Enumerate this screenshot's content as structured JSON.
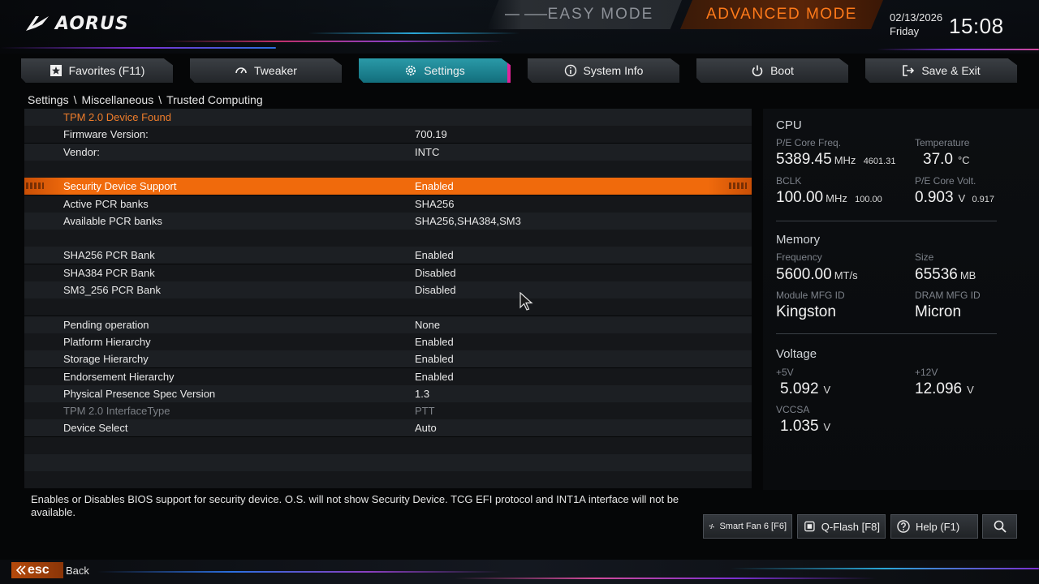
{
  "header": {
    "brand": "AORUS",
    "easy_mode": "EASY MODE",
    "advanced_mode": "ADVANCED MODE",
    "date": "02/13/2026",
    "day": "Friday",
    "time": "15:08",
    "accent_color": "#ff7a1a"
  },
  "tabs": [
    {
      "label": "Favorites (F11)",
      "icon": "star-icon",
      "active": false
    },
    {
      "label": "Tweaker",
      "icon": "gauge-icon",
      "active": false
    },
    {
      "label": "Settings",
      "icon": "gear-icon",
      "active": true
    },
    {
      "label": "System Info",
      "icon": "info-icon",
      "active": false
    },
    {
      "label": "Boot",
      "icon": "power-icon",
      "active": false
    },
    {
      "label": "Save & Exit",
      "icon": "exit-icon",
      "active": false
    }
  ],
  "breadcrumb": [
    "Settings",
    "Miscellaneous",
    "Trusted Computing"
  ],
  "breadcrumb_sep": "\\",
  "settings": [
    {
      "label": "TPM 2.0 Device Found",
      "value": "",
      "style": "header"
    },
    {
      "label": "Firmware Version:",
      "value": "700.19"
    },
    {
      "label": "Vendor:",
      "value": "INTC"
    },
    {
      "label": "",
      "value": ""
    },
    {
      "label": "Security Device Support",
      "value": "Enabled",
      "style": "selected"
    },
    {
      "label": "Active PCR banks",
      "value": "SHA256"
    },
    {
      "label": "Available PCR banks",
      "value": "SHA256,SHA384,SM3"
    },
    {
      "label": "",
      "value": ""
    },
    {
      "label": "SHA256 PCR Bank",
      "value": "Enabled"
    },
    {
      "label": "SHA384 PCR Bank",
      "value": "Disabled"
    },
    {
      "label": "SM3_256 PCR Bank",
      "value": "Disabled"
    },
    {
      "label": "",
      "value": ""
    },
    {
      "label": "Pending operation",
      "value": "None"
    },
    {
      "label": "Platform Hierarchy",
      "value": "Enabled"
    },
    {
      "label": "Storage Hierarchy",
      "value": "Enabled"
    },
    {
      "label": "Endorsement Hierarchy",
      "value": "Enabled"
    },
    {
      "label": "Physical Presence Spec Version",
      "value": "1.3"
    },
    {
      "label": "TPM 2.0 InterfaceType",
      "value": "PTT",
      "style": "dim"
    },
    {
      "label": "Device Select",
      "value": "Auto"
    },
    {
      "label": "",
      "value": ""
    },
    {
      "label": "",
      "value": ""
    },
    {
      "label": "",
      "value": ""
    }
  ],
  "monitor": {
    "cpu": {
      "title": "CPU",
      "freq_label": "P/E Core Freq.",
      "freq_value": "5389.45",
      "freq_unit": "MHz",
      "freq_secondary": "4601.31",
      "temp_label": "Temperature",
      "temp_value": "37.0",
      "temp_unit": "°C",
      "bclk_label": "BCLK",
      "bclk_value": "100.00",
      "bclk_unit": "MHz",
      "bclk_secondary": "100.00",
      "volt_label": "P/E Core Volt.",
      "volt_value": "0.903",
      "volt_unit": "V",
      "volt_secondary": "0.917"
    },
    "memory": {
      "title": "Memory",
      "freq_label": "Frequency",
      "freq_value": "5600.00",
      "freq_unit": "MT/s",
      "size_label": "Size",
      "size_value": "65536",
      "size_unit": "MB",
      "module_label": "Module MFG ID",
      "module_value": "Kingston",
      "dram_label": "DRAM MFG ID",
      "dram_value": "Micron"
    },
    "voltage": {
      "title": "Voltage",
      "v5_label": "+5V",
      "v5_value": "5.092",
      "v12_label": "+12V",
      "v12_value": "12.096",
      "vccsa_label": "VCCSA",
      "vccsa_value": "1.035",
      "unit": "V"
    }
  },
  "help_text": "Enables or Disables BIOS support for security device. O.S. will not show Security Device. TCG EFI protocol and INT1A interface will not be available.",
  "bottom_buttons": [
    {
      "label": "Smart Fan 6 [F6]",
      "icon": "fan-icon"
    },
    {
      "label": "Q-Flash [F8]",
      "icon": "chip-icon"
    },
    {
      "label": "Help (F1)",
      "icon": "help-icon"
    },
    {
      "label": "",
      "icon": "search-icon"
    }
  ],
  "footer": {
    "esc_label": "esc",
    "back_label": "Back"
  }
}
